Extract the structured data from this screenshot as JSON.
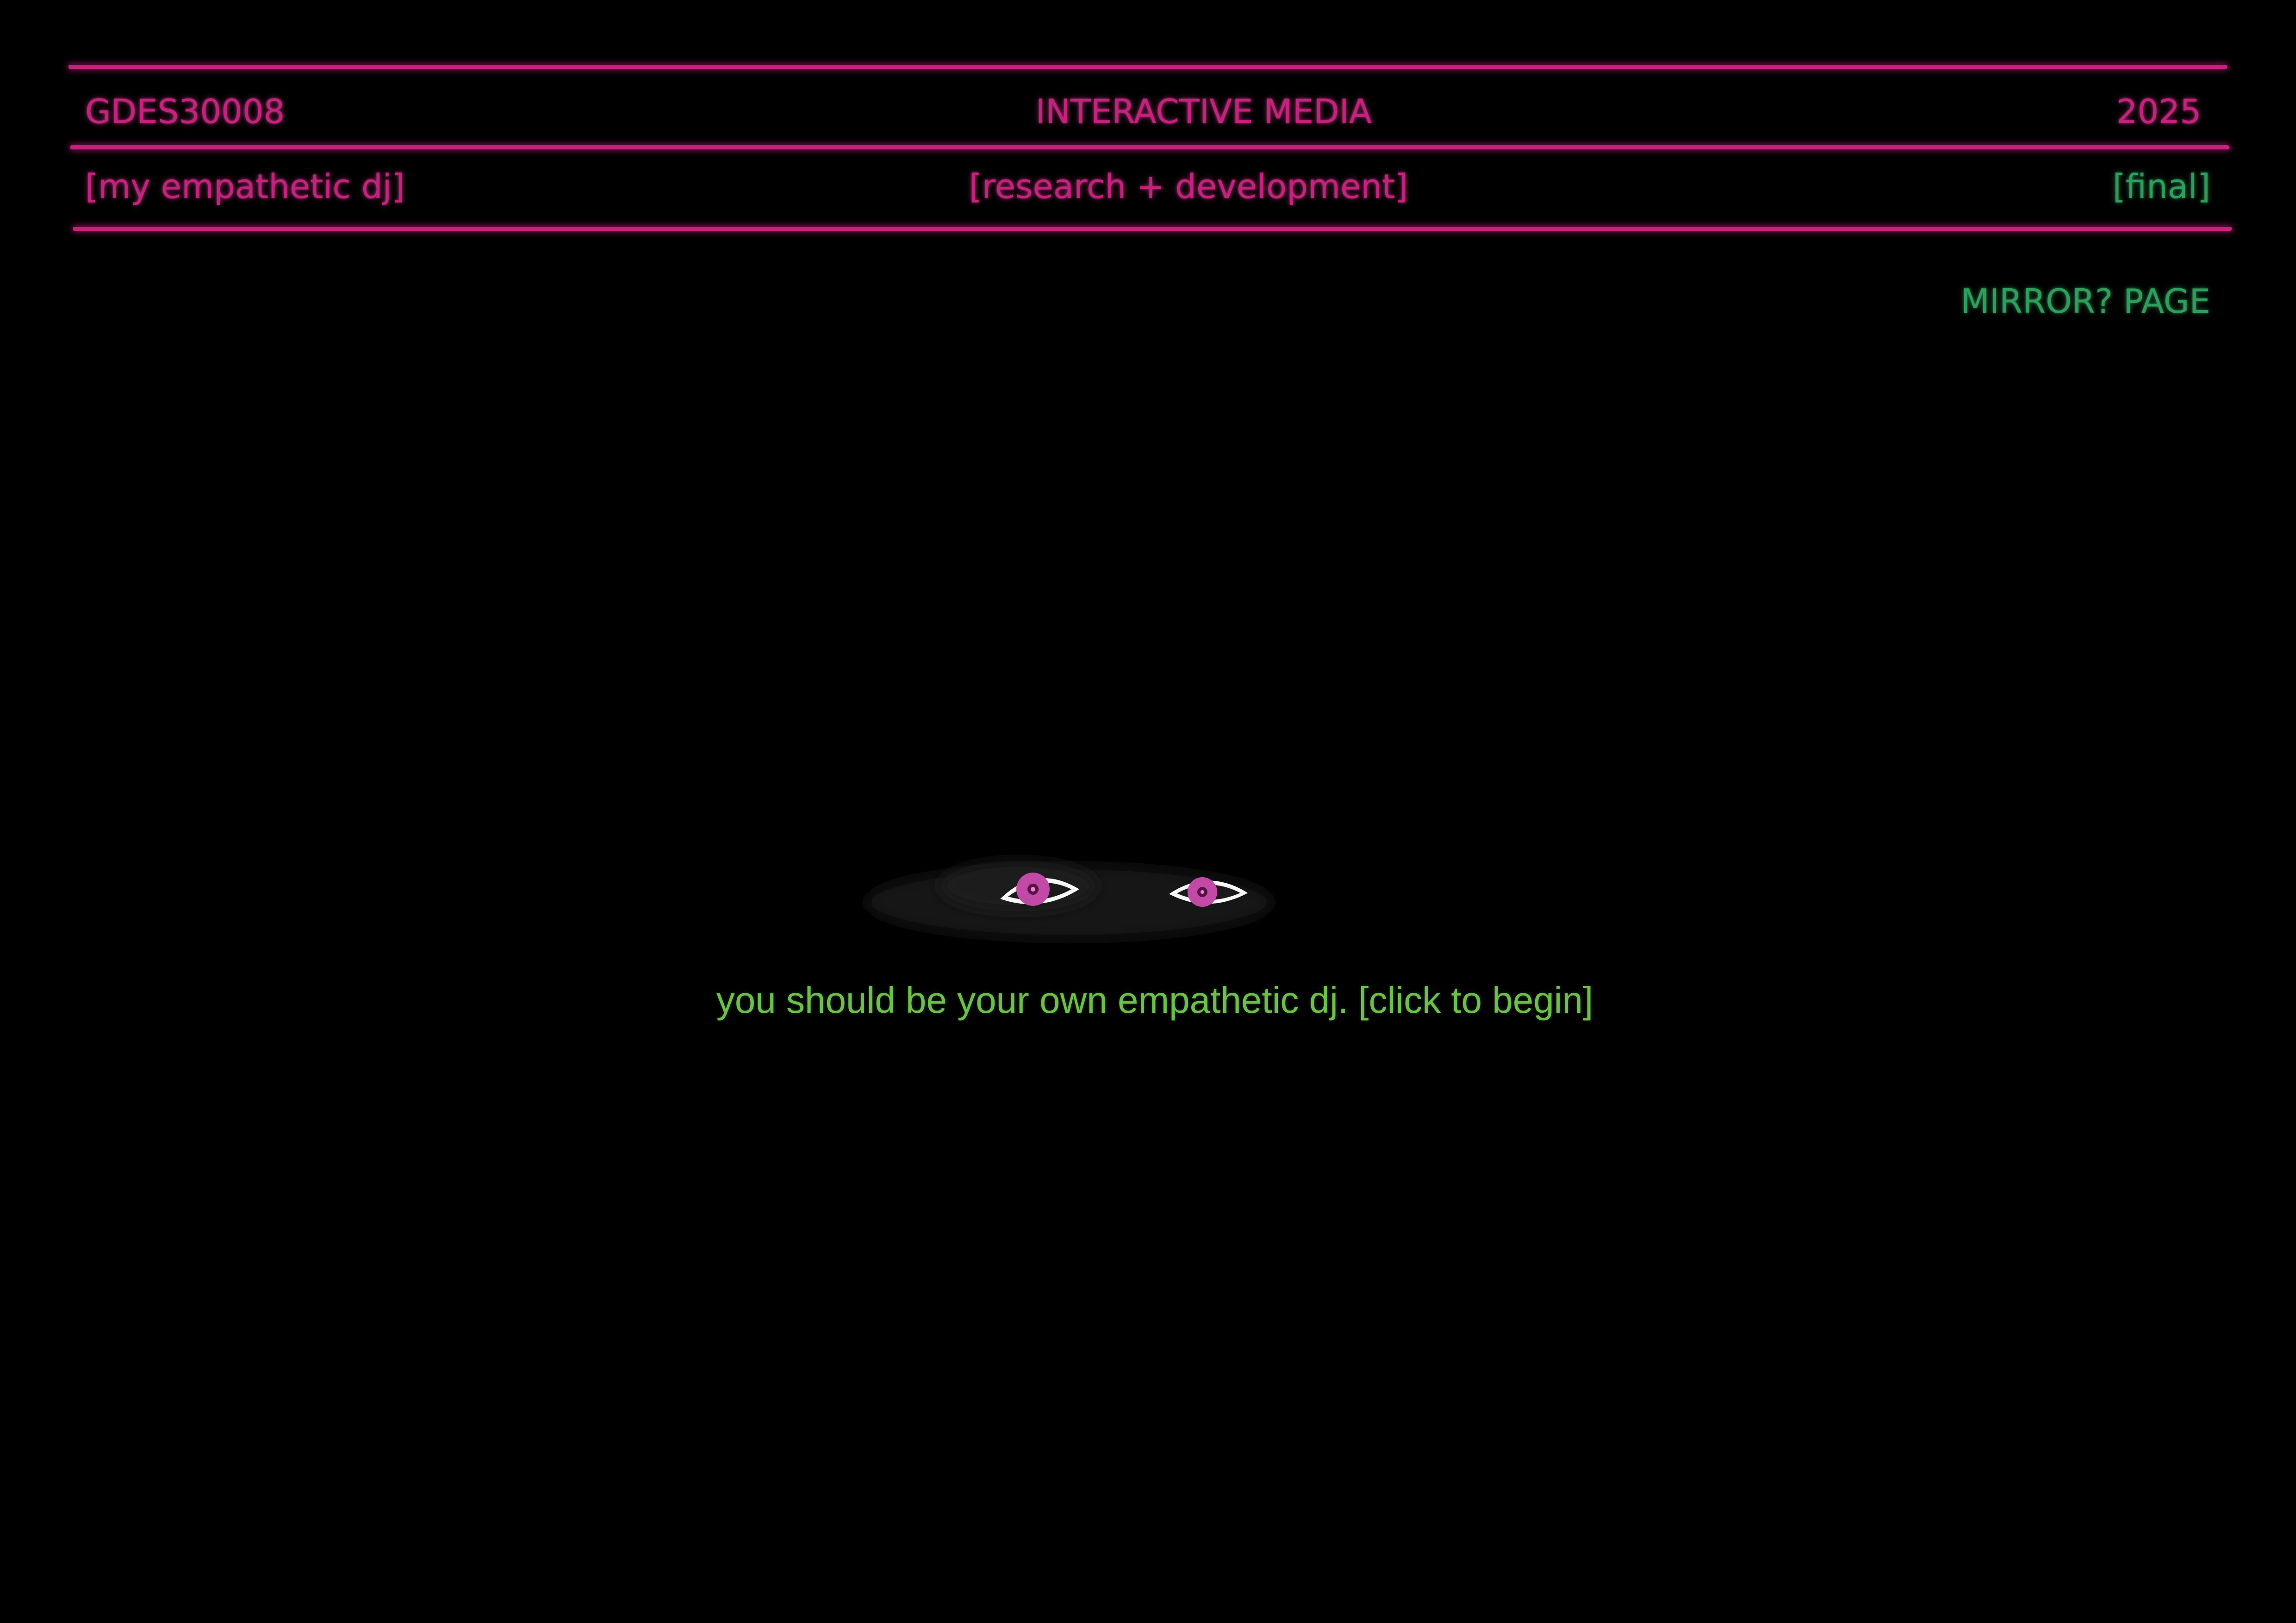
{
  "header": {
    "course_code": "GDES30008",
    "course_title": "INTERACTIVE MEDIA",
    "year": "2025",
    "project": "[my empathetic dj]",
    "section": "[research + development]",
    "stage": "[final]"
  },
  "nav": {
    "mirror_link": "MIRROR? PAGE"
  },
  "main": {
    "prompt": "you should be your own empathetic dj. [click to begin]"
  },
  "colors": {
    "background": "#000000",
    "accent_pink": "#c7217f",
    "accent_green": "#2e9e5c",
    "prompt_green": "#6cc04a",
    "iris": "#c24aa6"
  },
  "icons": {
    "eyes": "eyes-icon"
  }
}
